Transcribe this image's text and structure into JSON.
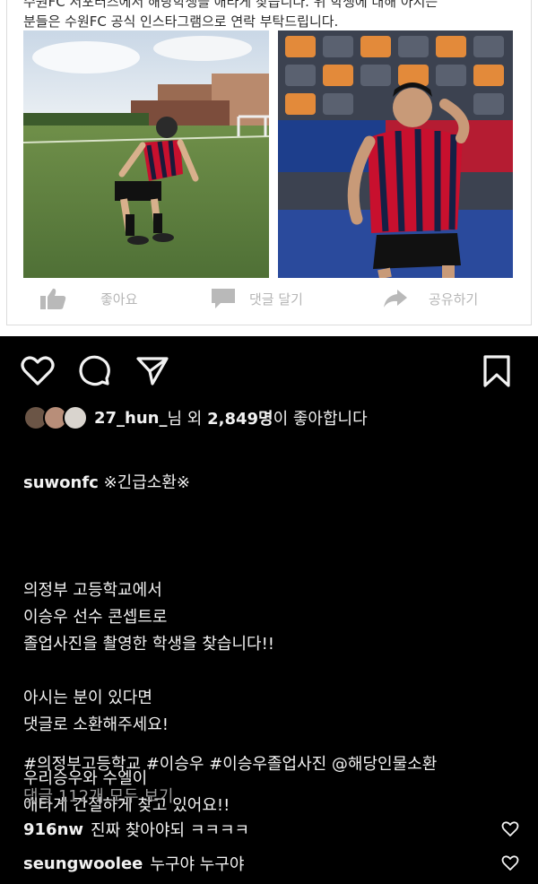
{
  "fb_post": {
    "text_line1": "수원FC 서포터즈에서 해당학생을 애타게 찾습니다. 위 학생에 대해 아시는",
    "text_line2": "분들은 수원FC 공식 인스타그램으로 연락 부탁드립니다.",
    "actions": [
      {
        "label": "좋아요",
        "icon": "thumbs-up-icon"
      },
      {
        "label": "댓글 달기",
        "icon": "comment-bubble-icon"
      },
      {
        "label": "공유하기",
        "icon": "share-arrow-icon"
      }
    ]
  },
  "ig": {
    "actions": [
      "heart-icon",
      "comment-icon",
      "send-icon",
      "bookmark-icon"
    ],
    "likes": {
      "user": "27_hun_",
      "middle": "님 외 ",
      "count": "2,849명",
      "suffix": "이 좋아합니다"
    },
    "caption": {
      "username": "suwonfc",
      "headline": " ※긴급소환※",
      "body": "의정부 고등학교에서\n이승우 선수 콘셉트로\n졸업사진을 촬영한 학생을 찾습니다!!\n\n아시는 분이 있다면\n댓글로 소환해주세요!\n\n우리승우와 수엘이\n애타게 간절하게 찾고 있어요!!"
    },
    "hashtags": "#의정부고등학교 #이승우 #이승우졸업사진 @해당인물소환",
    "view_all_comments": "댓글 112개 모두 보기",
    "comments": [
      {
        "user": "916nw",
        "text": "진짜 찾아야되 ㅋㅋㅋㅋ"
      },
      {
        "user": "seungwoolee",
        "text": "누구야 누구야"
      }
    ]
  },
  "colors": {
    "background": "#000000",
    "text": "#f2f2f2",
    "muted": "#9b9b9b",
    "fb_gray": "#b6b6b6",
    "jersey_red": "#c8102e"
  }
}
